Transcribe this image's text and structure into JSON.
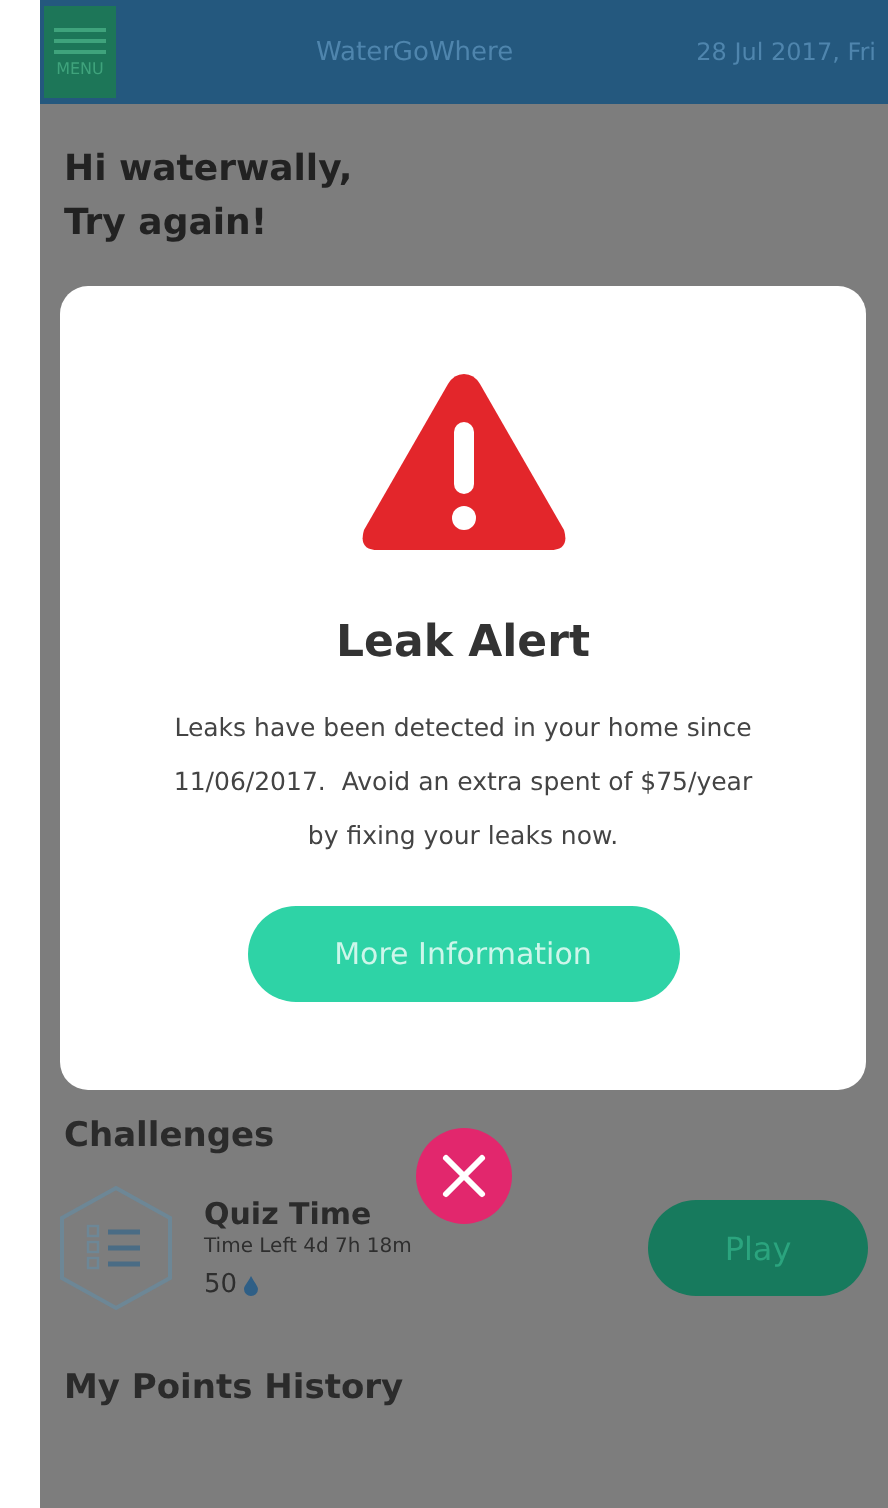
{
  "header": {
    "menu_label": "MENU",
    "title": "WaterGoWhere",
    "date": "28 Jul 2017, Fri"
  },
  "greeting": [
    "Hi waterwally,",
    "Try again!"
  ],
  "dialog": {
    "title": "Leak Alert",
    "message": "Leaks have been detected in your home since 11/06/2017.  Avoid an extra spent of $75/year by fixing your leaks now.",
    "button": "More Information"
  },
  "challenges": {
    "title": "Challenges",
    "items": [
      {
        "title": "Quiz Time",
        "time_left": "Time Left 4d 7h 18m",
        "points": "50",
        "button": "Play"
      }
    ]
  },
  "points_history": {
    "title": "My Points History"
  }
}
